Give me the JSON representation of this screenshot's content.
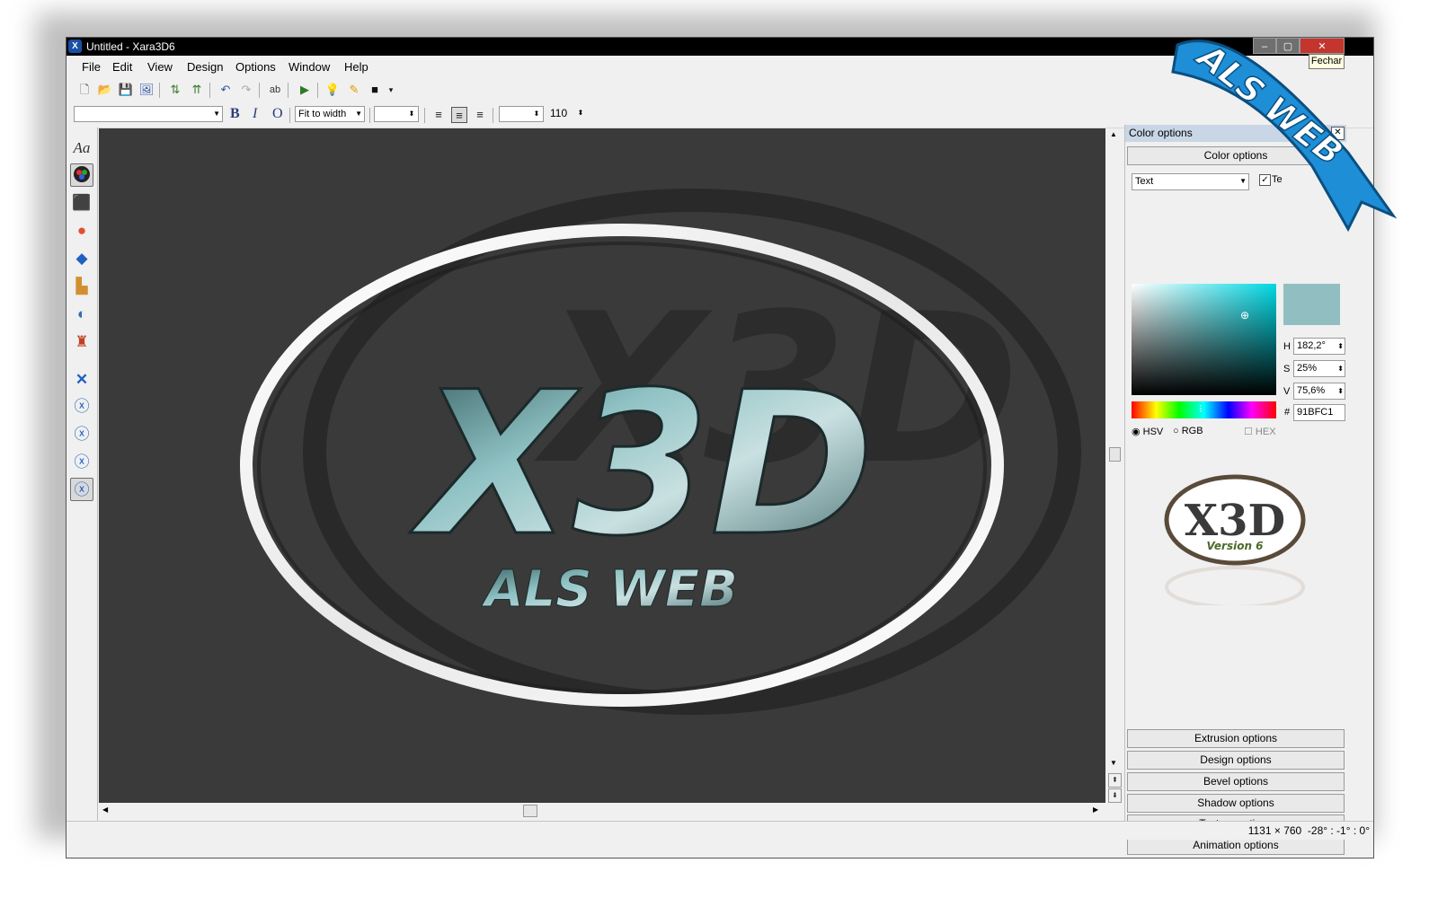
{
  "window": {
    "title": "Untitled - Xara3D6",
    "app_icon_glyph": "X",
    "minimize": "‒",
    "maximize": "▢",
    "close": "✕"
  },
  "tooltip": {
    "text": "Fechar"
  },
  "menu": [
    "File",
    "Edit",
    "View",
    "Design",
    "Options",
    "Window",
    "Help"
  ],
  "toolbar": {
    "zoom_value": "Fit to width",
    "size_value": "110",
    "bold": "B",
    "italic": "I",
    "outline": "O"
  },
  "left_tools": {
    "text_tool": "Aa"
  },
  "canvas": {
    "main_text": "X3D",
    "sub_text": "ALS WEB",
    "back_text": "X3D"
  },
  "color_panel": {
    "header": "Color options",
    "section_title": "Color options",
    "target_select": "Text",
    "checkbox_label": "Te",
    "h_label": "H",
    "h_value": "182,2°",
    "s_label": "S",
    "s_value": "25%",
    "v_label": "V",
    "v_value": "75,6%",
    "hash_label": "#",
    "hex_value": "91BFC1",
    "modes": [
      "HSV",
      "RGB",
      "HEX"
    ],
    "swatch_color": "#91bfc1"
  },
  "preview": {
    "text": "X3D",
    "version": "Version 6"
  },
  "sections": [
    "Extrusion options",
    "Design options",
    "Bevel options",
    "Shadow options",
    "Texture options",
    "Animation options"
  ],
  "status": {
    "dimensions": "1131 × 760",
    "rotation": "-28° : -1° : 0°"
  },
  "watermark": {
    "text": "ALS WEB"
  }
}
